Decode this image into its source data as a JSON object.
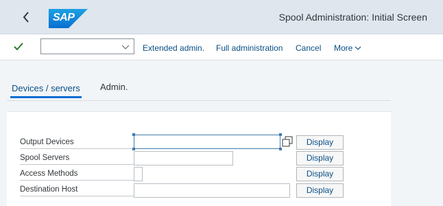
{
  "shell": {
    "logo_text": "SAP",
    "title": "Spool Administration: Initial Screen",
    "colors": {
      "header_bg": "#dfe6ee",
      "logo_bg": "#0a6ed1",
      "link": "#0a4f84"
    }
  },
  "toolbar": {
    "command_value": "",
    "extended_admin": "Extended admin.",
    "full_administration": "Full administration",
    "cancel": "Cancel",
    "more": "More"
  },
  "tabs": [
    {
      "label": "Devices / servers",
      "selected": true
    },
    {
      "label": "Admin.",
      "selected": false
    }
  ],
  "form": {
    "rows": [
      {
        "label": "Output Devices",
        "value": "",
        "button": "Display"
      },
      {
        "label": "Spool Servers",
        "value": "",
        "button": "Display"
      },
      {
        "label": "Access Methods",
        "value": "",
        "button": "Display"
      },
      {
        "label": "Destination Host",
        "value": "",
        "button": "Display"
      }
    ]
  }
}
